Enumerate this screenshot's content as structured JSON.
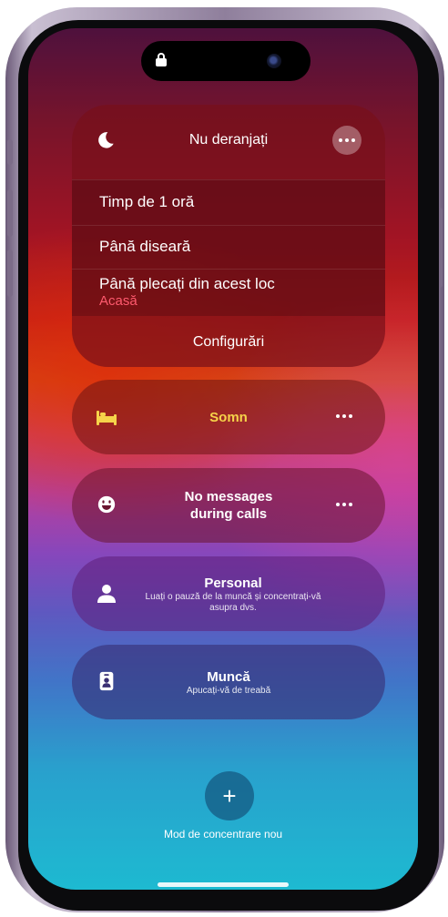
{
  "dnd": {
    "title": "Nu deranjați",
    "options": [
      {
        "label": "Timp de 1 oră"
      },
      {
        "label": "Până diseară"
      },
      {
        "label": "Până plecați din acest loc",
        "sub": "Acasă"
      }
    ],
    "settings_label": "Configurări"
  },
  "focus_modes": [
    {
      "title": "Somn",
      "subtitle": "",
      "icon": "bed-icon"
    },
    {
      "title": "No messages during calls",
      "subtitle": "",
      "icon": "smiley-icon"
    },
    {
      "title": "Personal",
      "subtitle": "Luați o pauză de la muncă și concentrați-vă asupra dvs.",
      "icon": "person-icon"
    },
    {
      "title": "Muncă",
      "subtitle": "Apucați-vă de treabă",
      "icon": "badge-icon"
    }
  ],
  "new_focus_label": "Mod de concentrare nou",
  "add_symbol": "+",
  "colors": {
    "sleep_accent": "#f6d34a",
    "dnd_sub_accent": "#ff5a6e"
  }
}
